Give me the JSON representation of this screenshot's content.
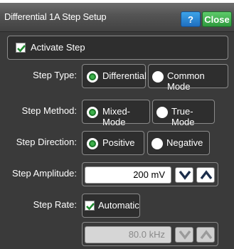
{
  "dialog": {
    "title": "Differential 1A Step Setup",
    "help_label": "?",
    "close_label": "Close"
  },
  "activate_step": {
    "label": "Activate Step",
    "checked": true
  },
  "step_type": {
    "label": "Step Type:",
    "options": [
      "Differential",
      "Common Mode"
    ],
    "selected": "Differential"
  },
  "step_method": {
    "label": "Step Method:",
    "options": [
      "Mixed-Mode",
      "True-Mode"
    ],
    "selected": "Mixed-Mode"
  },
  "step_direction": {
    "label": "Step Direction:",
    "options": [
      "Positive",
      "Negative"
    ],
    "selected": "Positive"
  },
  "step_amplitude": {
    "label": "Step Amplitude:",
    "value": "200 mV"
  },
  "step_rate": {
    "label": "Step Rate:",
    "automatic_label": "Automatic",
    "automatic_checked": true,
    "value": "80.0 kHz"
  },
  "colors": {
    "panel": "#3a3a3a",
    "radio_selected": "#3db04b",
    "help_button": "#1f6fc0",
    "close_button": "#2f9a3e"
  }
}
